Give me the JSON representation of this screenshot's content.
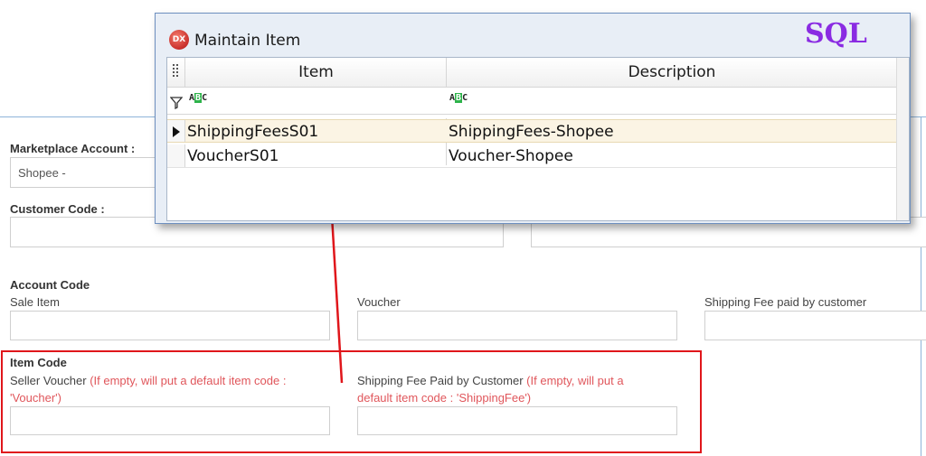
{
  "dialog": {
    "title": "Maintain Item",
    "app_icon_text": "DX",
    "badge": "SQL",
    "columns": [
      {
        "label": "Item"
      },
      {
        "label": "Description"
      }
    ],
    "filter_icon_text": "ABC",
    "rows": [
      {
        "item": "ShippingFeesS01",
        "description": "ShippingFees-Shopee",
        "selected": true
      },
      {
        "item": "VoucherS01",
        "description": "Voucher-Shopee",
        "selected": false
      }
    ]
  },
  "form": {
    "marketplace": {
      "label": "Marketplace Account :",
      "value": "Shopee -"
    },
    "customer": {
      "label": "Customer Code :",
      "value": ""
    },
    "account_code": {
      "heading": "Account Code",
      "sale_item_label": "Sale Item",
      "voucher_label": "Voucher",
      "shipping_label": "Shipping Fee paid by customer"
    },
    "item_code": {
      "heading": "Item Code",
      "seller_voucher_label": "Seller Voucher",
      "seller_voucher_note": "(If empty, will put a default item code : 'Voucher')",
      "shipping_label": "Shipping Fee Paid by Customer",
      "shipping_note": "(If empty, will put a default item code : 'ShippingFee')"
    }
  },
  "colors": {
    "highlight": "#e0161b",
    "badge": "#8a2be2",
    "note": "#e0565b",
    "selected_row": "#fbf4e4"
  }
}
